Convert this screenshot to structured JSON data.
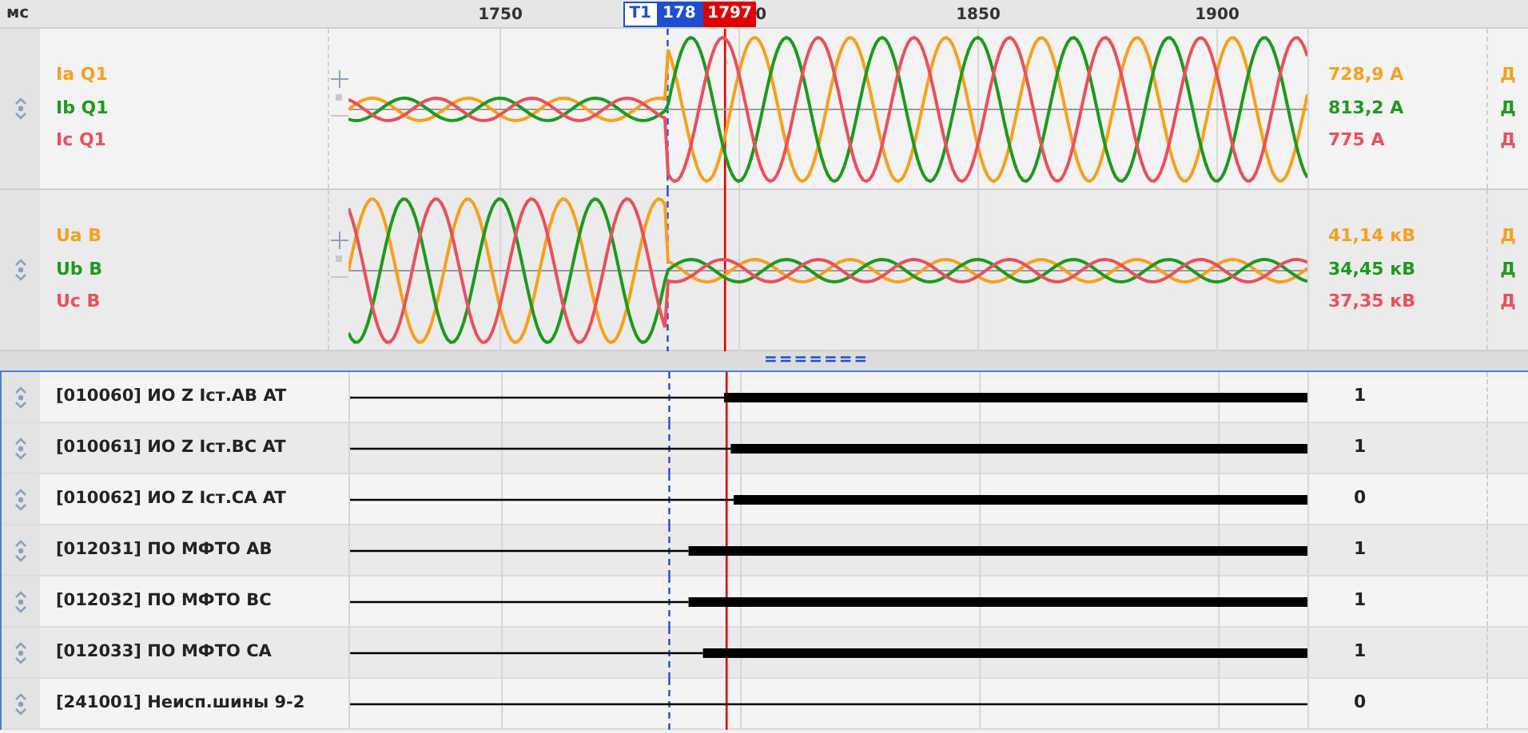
{
  "axis": {
    "unit": "мс",
    "ticks": [
      "1750",
      "0",
      "1850",
      "1900"
    ]
  },
  "markers": [
    {
      "kind": "t1",
      "label": "T1",
      "time": "178"
    },
    {
      "kind": "cursor",
      "time": "1797"
    }
  ],
  "analog_groups": [
    {
      "kind": "current",
      "channels": [
        {
          "name": "Ia Q1",
          "color": "#f5a01e",
          "value": "728,9 A",
          "flag": "Д"
        },
        {
          "name": "Ib Q1",
          "color": "#1d9a1d",
          "value": "813,2 A",
          "flag": "Д"
        },
        {
          "name": "Ic Q1",
          "color": "#e8505b",
          "value": "775 A",
          "flag": "Д"
        }
      ]
    },
    {
      "kind": "voltage",
      "channels": [
        {
          "name": "Ua B",
          "color": "#f5a01e",
          "value": "41,14 кВ",
          "flag": "Д"
        },
        {
          "name": "Ub B",
          "color": "#1d9a1d",
          "value": "34,45 кВ",
          "flag": "Д"
        },
        {
          "name": "Uc B",
          "color": "#e8505b",
          "value": "37,35 кВ",
          "flag": "Д"
        }
      ]
    }
  ],
  "splitter": "=======",
  "digital_signals": [
    {
      "name": "[010060] ИО Z Iст.AB AT",
      "level": 0.61,
      "value": "1"
    },
    {
      "name": "[010061] ИО Z Iст.BC AT",
      "level": 0.603,
      "value": "1"
    },
    {
      "name": "[010062] ИО Z Iст.CA AT",
      "level": 0.6,
      "value": "0"
    },
    {
      "name": "[012031] ПО МФТО AB",
      "level": 0.647,
      "value": "1"
    },
    {
      "name": "[012032] ПО МФТО BC",
      "level": 0.647,
      "value": "1"
    },
    {
      "name": "[012033] ПО МФТО CA",
      "level": 0.632,
      "value": "1"
    },
    {
      "name": "[241001] Неисп.шины 9-2",
      "level": 0,
      "value": "0"
    }
  ]
}
